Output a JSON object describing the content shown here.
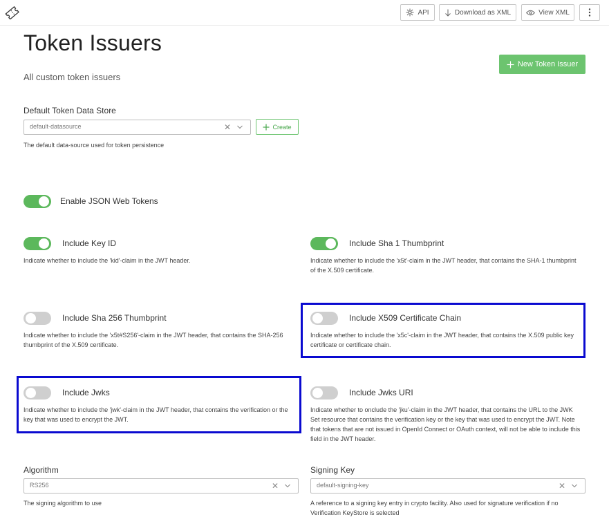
{
  "toolbar": {
    "api_label": "API",
    "download_label": "Download as XML",
    "view_label": "View XML"
  },
  "page": {
    "title": "Token Issuers",
    "subtitle": "All custom token issuers",
    "new_button": "New Token Issuer"
  },
  "datastore": {
    "label": "Default Token Data Store",
    "value": "default-datasource",
    "create_label": "Create",
    "help": "The default data-source used for token persistence"
  },
  "enable_jwt": {
    "label": "Enable JSON Web Tokens",
    "on": true
  },
  "options": {
    "key_id": {
      "label": "Include Key ID",
      "on": true,
      "help": "Indicate whether to include the 'kid'-claim in the JWT header."
    },
    "sha1": {
      "label": "Include Sha 1 Thumbprint",
      "on": true,
      "help": "Indicate whether to include the 'x5t'-claim in the JWT header, that contains the SHA-1 thumbprint of the X.509 certificate."
    },
    "sha256": {
      "label": "Include Sha 256 Thumbprint",
      "on": false,
      "help": "Indicate whether to include the 'x5t#S256'-claim in the JWT header, that contains the SHA-256 thumbprint of the X.509 certificate."
    },
    "x509": {
      "label": "Include X509 Certificate Chain",
      "on": false,
      "help": "Indicate whether to include the 'x5c'-claim in the JWT header, that contains the X.509 public key certificate or certificate chain."
    },
    "jwks": {
      "label": "Include Jwks",
      "on": false,
      "help": "Indicate whether to include the 'jwk'-claim in the JWT header, that contains the verification or the key that was used to encrypt the JWT."
    },
    "jwks_uri": {
      "label": "Include Jwks URI",
      "on": false,
      "help": "Indicate whether to onclude the 'jku'-claim in the JWT header, that contains the URL to the JWK Set resource that contains the verification key or the key that was used to encrypt the JWT. Note that tokens that are not issued in OpenId Connect or OAuth context, will not be able to include this field in the JWT header."
    }
  },
  "algorithm": {
    "label": "Algorithm",
    "value": "RS256",
    "help": "The signing algorithm to use"
  },
  "signing_key": {
    "label": "Signing Key",
    "value": "default-signing-key",
    "help": "A reference to a signing key entry in crypto facility. Also used for signature verification if no Verification KeyStore is selected"
  },
  "colors": {
    "accent": "#5cb85c",
    "button_green": "#6cc46f",
    "highlight": "#0a0ad0"
  }
}
